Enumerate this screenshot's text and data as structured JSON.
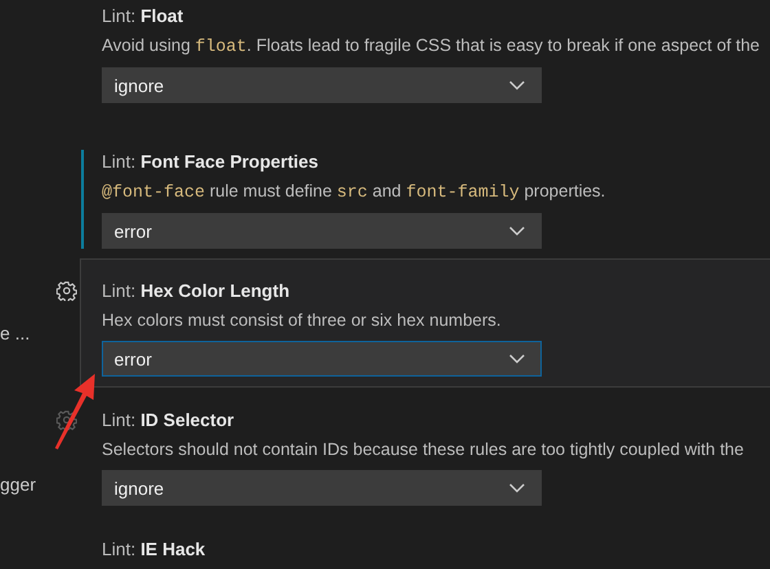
{
  "sidebar": {
    "items": [
      {
        "label": "e ..."
      },
      {
        "label": "gger"
      }
    ]
  },
  "settings": [
    {
      "category": "Lint: ",
      "title": "Float",
      "description": [
        {
          "kind": "text",
          "text": "Avoid using "
        },
        {
          "kind": "code",
          "text": "float"
        },
        {
          "kind": "text",
          "text": ". Floats lead to fragile CSS that is easy to break if one aspect of the"
        }
      ],
      "value": "ignore",
      "modified": false,
      "focused": false,
      "hovered": false
    },
    {
      "category": "Lint: ",
      "title": "Font Face Properties",
      "description": [
        {
          "kind": "code",
          "text": "@font-face"
        },
        {
          "kind": "text",
          "text": " rule must define "
        },
        {
          "kind": "code",
          "text": "src"
        },
        {
          "kind": "text",
          "text": " and "
        },
        {
          "kind": "code",
          "text": "font-family"
        },
        {
          "kind": "text",
          "text": " properties."
        }
      ],
      "value": "error",
      "modified": true,
      "focused": false,
      "hovered": false
    },
    {
      "category": "Lint: ",
      "title": "Hex Color Length",
      "description": [
        {
          "kind": "text",
          "text": "Hex colors must consist of three or six hex numbers."
        }
      ],
      "value": "error",
      "modified": false,
      "focused": true,
      "hovered": false
    },
    {
      "category": "Lint: ",
      "title": "ID Selector",
      "description": [
        {
          "kind": "text",
          "text": "Selectors should not contain IDs because these rules are too tightly coupled with the"
        }
      ],
      "value": "ignore",
      "modified": false,
      "focused": false,
      "hovered": true
    },
    {
      "category": "Lint: ",
      "title": "IE Hack",
      "modified": false,
      "focused": false,
      "hovered": false
    }
  ]
}
